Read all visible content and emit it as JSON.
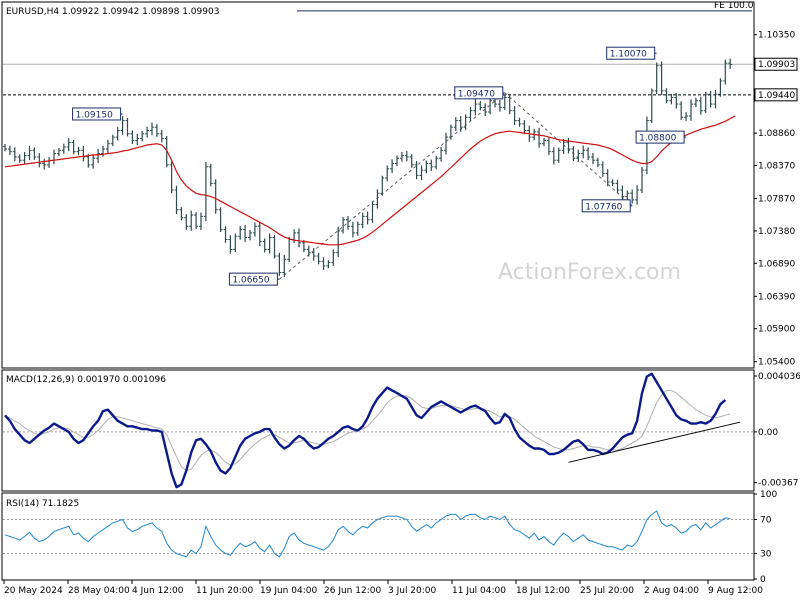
{
  "chart_data": {
    "type": "candlestick",
    "header": "EURUSD,H4  1.09922 1.09942 1.09898 1.09903",
    "watermark": "ActionForex.com",
    "x_ticks": [
      "20 May 2024",
      "28 May 04:00",
      "4 Jun 12:00",
      "11 Jun 20:00",
      "19 Jun 04:00",
      "26 Jun 12:00",
      "3 Jul 20:00",
      "11 Jul 04:00",
      "18 Jul 12:00",
      "25 Jul 20:00",
      "2 Aug 04:00",
      "9 Aug 12:00"
    ],
    "price_axis": {
      "ylim": [
        1.0532,
        1.1083
      ],
      "ticks": [
        1.1035,
        1.0986,
        1.0937,
        1.0886,
        1.0837,
        1.0787,
        1.0738,
        1.0689,
        1.0639,
        1.059,
        1.054
      ],
      "tick_labels": [
        "1.10350",
        "1.09860",
        "",
        "1.08860",
        "1.08370",
        "1.07870",
        "1.07380",
        "1.06890",
        "1.06390",
        "1.05900",
        "1.05400"
      ],
      "current_price_label": "1.09903",
      "current_price": 1.09903,
      "level_label": "1.09440",
      "level_price": 1.0944,
      "fe_label": "FE 100.0",
      "fe_price": 1.1071
    },
    "annotations": [
      {
        "text": "1.09150",
        "bar": 24,
        "price": 1.0915,
        "side": "left"
      },
      {
        "text": "1.06650",
        "bar": 56,
        "price": 1.0665,
        "side": "left"
      },
      {
        "text": "1.09470",
        "bar": 102,
        "price": 1.0947,
        "side": "left"
      },
      {
        "text": "1.07760",
        "bar": 128,
        "price": 1.0776,
        "side": "left"
      },
      {
        "text": "1.10070",
        "bar": 133,
        "price": 1.1007,
        "side": "left"
      },
      {
        "text": "1.08800",
        "bar": 139,
        "price": 1.088,
        "side": "left"
      }
    ],
    "close": [
      1.0862,
      1.0858,
      1.085,
      1.0845,
      1.0852,
      1.086,
      1.085,
      1.084,
      1.0838,
      1.0845,
      1.0855,
      1.086,
      1.0865,
      1.0872,
      1.0858,
      1.086,
      1.085,
      1.0838,
      1.0848,
      1.0855,
      1.0862,
      1.087,
      1.088,
      1.089,
      1.0905,
      1.0885,
      1.0875,
      1.0878,
      1.0885,
      1.089,
      1.0895,
      1.0885,
      1.0878,
      1.0838,
      1.08,
      1.077,
      1.0758,
      1.0745,
      1.0762,
      1.0745,
      1.076,
      1.0835,
      1.081,
      1.077,
      1.074,
      1.0725,
      1.071,
      1.073,
      1.074,
      1.0728,
      1.0735,
      1.0745,
      1.0722,
      1.071,
      1.0728,
      1.07,
      1.0675,
      1.0695,
      1.0725,
      1.0735,
      1.072,
      1.071,
      1.0705,
      1.07,
      1.0692,
      1.0685,
      1.069,
      1.0705,
      1.0738,
      1.0755,
      1.0745,
      1.0735,
      1.0748,
      1.076,
      1.0755,
      1.0778,
      1.0795,
      1.0818,
      1.0832,
      1.084,
      1.0848,
      1.0852,
      1.085,
      1.0838,
      1.0822,
      1.083,
      1.084,
      1.0835,
      1.0848,
      1.086,
      1.088,
      1.0895,
      1.0905,
      1.0895,
      1.091,
      1.092,
      1.093,
      1.0925,
      1.0918,
      1.0935,
      1.093,
      1.0925,
      1.094,
      1.092,
      1.0905,
      1.09,
      1.089,
      1.088,
      1.0888,
      1.087,
      1.0875,
      1.0858,
      1.0845,
      1.086,
      1.0872,
      1.0862,
      1.0848,
      1.0855,
      1.086,
      1.085,
      1.0845,
      1.0838,
      1.0825,
      1.0812,
      1.081,
      1.08,
      1.079,
      1.0795,
      1.0785,
      1.08,
      1.083,
      1.0905,
      1.095,
      1.0988,
      1.095,
      1.0935,
      1.094,
      1.093,
      1.091,
      1.0912,
      1.093,
      1.0935,
      1.092,
      1.0945,
      1.093,
      1.0945,
      1.0965,
      1.0992,
      1.099
    ],
    "ma": [
      1.0835,
      1.0836,
      1.0837,
      1.0838,
      1.0839,
      1.084,
      1.0841,
      1.0842,
      1.0843,
      1.0844,
      1.0845,
      1.0846,
      1.0847,
      1.0848,
      1.0849,
      1.085,
      1.0851,
      1.0852,
      1.0853,
      1.0853,
      1.0854,
      1.0855,
      1.0856,
      1.0857,
      1.0859,
      1.086,
      1.0862,
      1.0864,
      1.0866,
      1.0868,
      1.0869,
      1.087,
      1.0868,
      1.086,
      1.0845,
      1.0828,
      1.0815,
      1.0806,
      1.08,
      1.0795,
      1.0793,
      1.0792,
      1.079,
      1.0787,
      1.0783,
      1.0779,
      1.0775,
      1.0771,
      1.0767,
      1.0763,
      1.0759,
      1.0755,
      1.0751,
      1.0747,
      1.0743,
      1.0738,
      1.0733,
      1.0729,
      1.0726,
      1.0724,
      1.0723,
      1.0722,
      1.0721,
      1.072,
      1.0719,
      1.0718,
      1.0717,
      1.0717,
      1.0717,
      1.0718,
      1.072,
      1.0722,
      1.0724,
      1.0727,
      1.0731,
      1.0736,
      1.0742,
      1.0748,
      1.0754,
      1.076,
      1.0766,
      1.0772,
      1.0778,
      1.0784,
      1.079,
      1.0796,
      1.0802,
      1.0808,
      1.0814,
      1.082,
      1.0827,
      1.0834,
      1.0841,
      1.0848,
      1.0855,
      1.0862,
      1.0868,
      1.0874,
      1.0878,
      1.0882,
      1.0885,
      1.0887,
      1.0888,
      1.0889,
      1.0888,
      1.0887,
      1.0886,
      1.0885,
      1.0884,
      1.0883,
      1.0882,
      1.088,
      1.0878,
      1.0876,
      1.0875,
      1.0874,
      1.0873,
      1.0872,
      1.0871,
      1.087,
      1.0869,
      1.0868,
      1.0866,
      1.0864,
      1.0861,
      1.0857,
      1.0853,
      1.0849,
      1.0845,
      1.0842,
      1.084,
      1.084,
      1.0843,
      1.085,
      1.0859,
      1.0866,
      1.0872,
      1.0877,
      1.088,
      1.0883,
      1.0886,
      1.0889,
      1.0892,
      1.0894,
      1.0896,
      1.0898,
      1.0901,
      1.0904,
      1.0908,
      1.0912
    ],
    "panels": [
      {
        "name": "MACD(12,26,9) 0.001970 0.001096",
        "ylim": [
          -0.0042,
          0.0044
        ],
        "ticks": [
          0.004036,
          0.0,
          -0.00367
        ],
        "tick_labels": [
          "0.004036",
          "0.00",
          "-0.00367"
        ],
        "macd": [
          0.0012,
          0.0008,
          0.0002,
          -0.0002,
          -0.0006,
          -0.0008,
          -0.0005,
          -0.0002,
          0.0001,
          0.0003,
          0.0006,
          0.0004,
          0.0002,
          0.0,
          -0.0005,
          -0.0008,
          -0.0006,
          -0.0001,
          0.0004,
          0.0008,
          0.0015,
          0.0016,
          0.0012,
          0.0008,
          0.0006,
          0.0004,
          0.0004,
          0.0003,
          0.0002,
          0.0002,
          0.0001,
          0.0001,
          0.0,
          -0.0015,
          -0.003,
          -0.004,
          -0.0038,
          -0.0028,
          -0.0015,
          -0.0006,
          -0.0005,
          -0.0009,
          -0.0014,
          -0.0022,
          -0.0028,
          -0.003,
          -0.0026,
          -0.0018,
          -0.001,
          -0.0005,
          -0.0003,
          -0.0001,
          0.0,
          0.0002,
          0.0002,
          -0.0004,
          -0.0009,
          -0.0012,
          -0.001,
          -0.0006,
          -0.0003,
          -0.0005,
          -0.0009,
          -0.0012,
          -0.0011,
          -0.0008,
          -0.0005,
          -0.0003,
          0.0,
          0.0003,
          0.0004,
          0.0002,
          0.0001,
          0.0004,
          0.001,
          0.0018,
          0.0024,
          0.0028,
          0.0032,
          0.003,
          0.0028,
          0.0026,
          0.0024,
          0.0018,
          0.0012,
          0.001,
          0.0014,
          0.0018,
          0.002,
          0.0022,
          0.002,
          0.0018,
          0.0016,
          0.0014,
          0.0016,
          0.0018,
          0.0019,
          0.0017,
          0.0015,
          0.001,
          0.0006,
          0.0007,
          0.0013,
          0.001,
          0.0002,
          -0.0004,
          -0.0007,
          -0.001,
          -0.0012,
          -0.0012,
          -0.0013,
          -0.0016,
          -0.0016,
          -0.0015,
          -0.0013,
          -0.001,
          -0.0007,
          -0.0006,
          -0.0009,
          -0.0013,
          -0.0013,
          -0.0014,
          -0.0016,
          -0.0015,
          -0.0012,
          -0.0008,
          -0.0004,
          -0.0002,
          -0.0001,
          0.0008,
          0.0028,
          0.004,
          0.0042,
          0.0036,
          0.003,
          0.0024,
          0.0018,
          0.0012,
          0.0009,
          0.0008,
          0.0006,
          0.0006,
          0.0007,
          0.0006,
          0.0008,
          0.0013,
          0.002,
          0.0023
        ],
        "signal": [
          0.0011,
          0.001,
          0.0008,
          0.0006,
          0.0003,
          0.0001,
          -0.0001,
          -0.0002,
          -0.0001,
          0.0,
          0.0002,
          0.0003,
          0.0003,
          0.0002,
          0.0,
          -0.0002,
          -0.0004,
          -0.0004,
          -0.0002,
          0.0001,
          0.0005,
          0.0009,
          0.0011,
          0.0011,
          0.001,
          0.0009,
          0.0008,
          0.0007,
          0.0006,
          0.0005,
          0.0004,
          0.0003,
          0.0002,
          -0.0002,
          -0.001,
          -0.0018,
          -0.0025,
          -0.0028,
          -0.0027,
          -0.0022,
          -0.0017,
          -0.0014,
          -0.0013,
          -0.0015,
          -0.0018,
          -0.0022,
          -0.0024,
          -0.0023,
          -0.002,
          -0.0016,
          -0.0012,
          -0.0009,
          -0.0006,
          -0.0004,
          -0.0002,
          -0.0002,
          -0.0004,
          -0.0006,
          -0.0008,
          -0.0008,
          -0.0007,
          -0.0006,
          -0.0007,
          -0.0008,
          -0.0009,
          -0.0009,
          -0.0008,
          -0.0007,
          -0.0005,
          -0.0003,
          -0.0001,
          0.0,
          0.0001,
          0.0002,
          0.0004,
          0.0008,
          0.0012,
          0.0016,
          0.0021,
          0.0024,
          0.0026,
          0.0026,
          0.0026,
          0.0024,
          0.0021,
          0.0018,
          0.0017,
          0.0017,
          0.0018,
          0.0019,
          0.0019,
          0.0019,
          0.0018,
          0.0017,
          0.0016,
          0.0016,
          0.0017,
          0.0017,
          0.0016,
          0.0015,
          0.0013,
          0.0011,
          0.0011,
          0.0011,
          0.0009,
          0.0006,
          0.0003,
          0.0,
          -0.0003,
          -0.0005,
          -0.0007,
          -0.0009,
          -0.0011,
          -0.0012,
          -0.0013,
          -0.0013,
          -0.0012,
          -0.0011,
          -0.001,
          -0.001,
          -0.0011,
          -0.0011,
          -0.0012,
          -0.0013,
          -0.0013,
          -0.0013,
          -0.0012,
          -0.001,
          -0.0008,
          -0.0006,
          -0.0003,
          0.0004,
          0.0013,
          0.0021,
          0.0027,
          0.003,
          0.003,
          0.0028,
          0.0025,
          0.0022,
          0.0019,
          0.0016,
          0.0014,
          0.0012,
          0.0011,
          0.001,
          0.0011,
          0.0012,
          0.0013
        ],
        "trendline": [
          {
            "bar": 115,
            "value": -0.0022
          },
          {
            "bar": 150,
            "value": 0.0007
          }
        ]
      },
      {
        "name": "RSI(14) 71.1825",
        "ylim": [
          0,
          100
        ],
        "ticks": [
          100,
          70,
          30,
          0
        ],
        "tick_labels": [
          "100",
          "70",
          "30",
          "0"
        ],
        "levels": [
          70,
          30
        ],
        "rsi": [
          52,
          50,
          48,
          46,
          50,
          55,
          48,
          44,
          46,
          50,
          56,
          58,
          60,
          62,
          52,
          54,
          48,
          44,
          50,
          54,
          58,
          62,
          66,
          68,
          70,
          60,
          56,
          58,
          62,
          64,
          66,
          60,
          56,
          42,
          34,
          30,
          28,
          26,
          34,
          30,
          38,
          62,
          50,
          40,
          34,
          30,
          28,
          36,
          42,
          38,
          40,
          44,
          36,
          32,
          40,
          30,
          26,
          36,
          50,
          54,
          46,
          42,
          40,
          38,
          36,
          34,
          38,
          46,
          58,
          62,
          56,
          52,
          58,
          62,
          60,
          66,
          70,
          72,
          74,
          74,
          74,
          72,
          70,
          62,
          56,
          60,
          64,
          60,
          66,
          70,
          74,
          76,
          76,
          70,
          74,
          76,
          76,
          72,
          70,
          74,
          72,
          70,
          74,
          64,
          58,
          56,
          52,
          48,
          54,
          46,
          50,
          44,
          40,
          48,
          54,
          50,
          44,
          48,
          52,
          46,
          44,
          42,
          40,
          38,
          38,
          36,
          34,
          40,
          38,
          44,
          56,
          70,
          76,
          80,
          66,
          62,
          64,
          60,
          54,
          56,
          62,
          64,
          58,
          66,
          60,
          64,
          68,
          72,
          71
        ]
      }
    ]
  }
}
